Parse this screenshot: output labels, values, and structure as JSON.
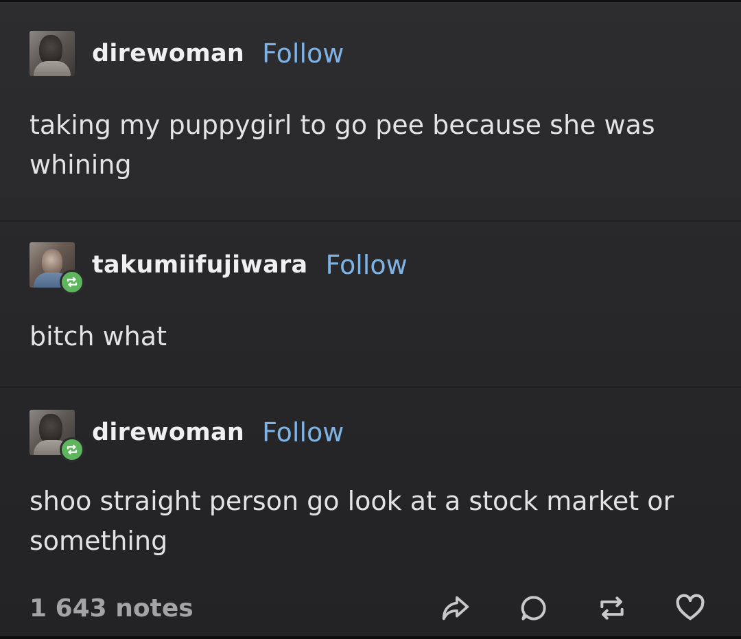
{
  "posts": [
    {
      "username": "direwoman",
      "follow_label": "Follow",
      "text": "taking my puppygirl to go pee because she was whining",
      "avatar_icon": "user-avatar-icon",
      "reblog": false
    },
    {
      "username": "takumiifujiwara",
      "follow_label": "Follow",
      "text": "bitch what",
      "avatar_icon": "user-avatar-icon",
      "reblog": true
    },
    {
      "username": "direwoman",
      "follow_label": "Follow",
      "text": "shoo straight person go look at a stock market or something",
      "avatar_icon": "user-avatar-icon",
      "reblog": true
    }
  ],
  "footer": {
    "notes": "1 643 notes",
    "actions": [
      "share-icon",
      "comment-icon",
      "reblog-icon",
      "heart-icon"
    ]
  },
  "colors": {
    "background": "#2a2a2c",
    "follow": "#7fb3e6",
    "reblog_badge": "#5fb55d",
    "text": "#e3e3e5"
  }
}
